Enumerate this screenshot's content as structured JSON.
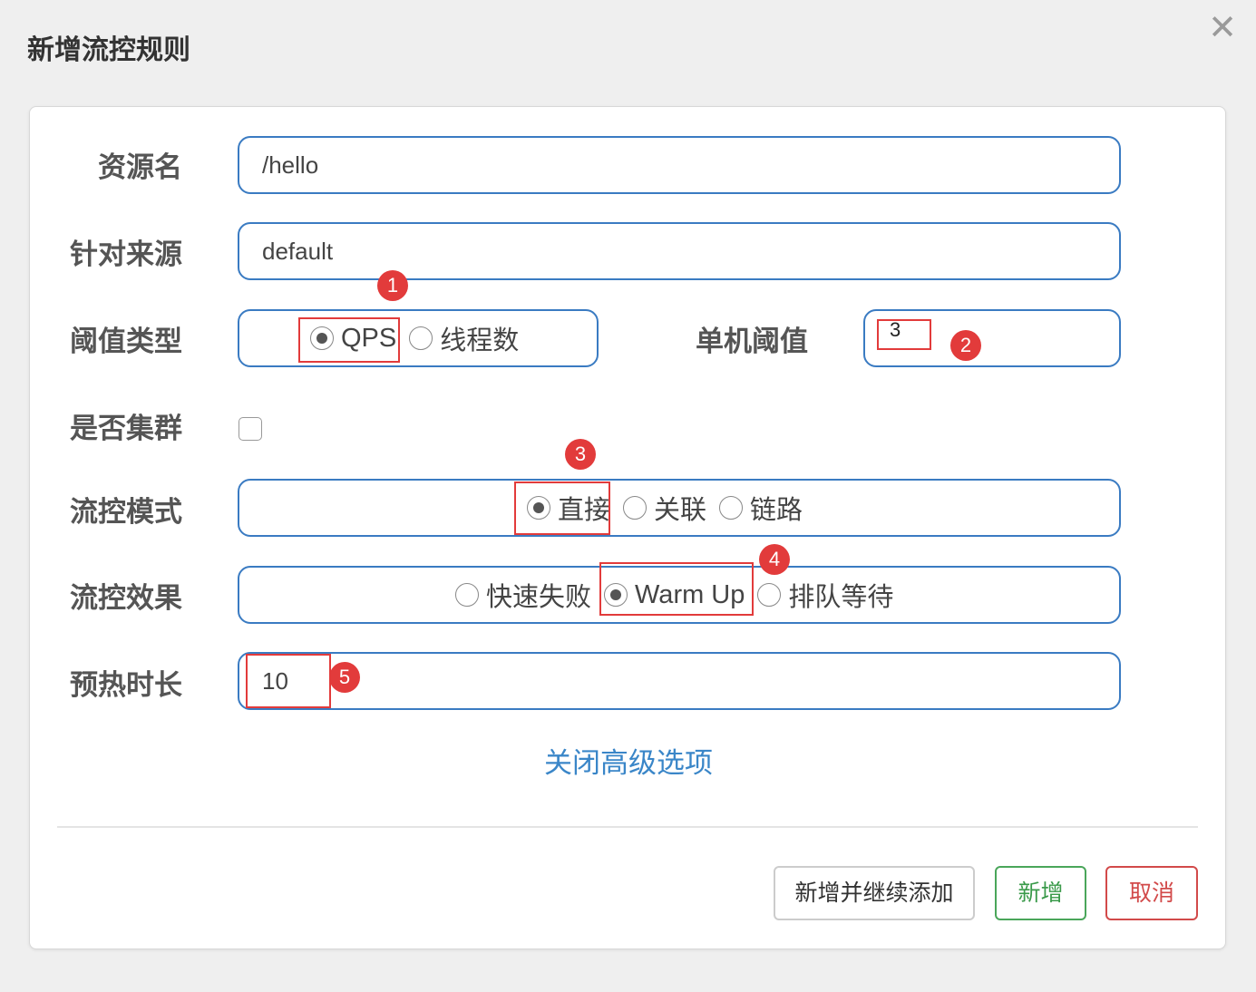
{
  "dialog": {
    "title": "新增流控规则",
    "close_glyph": "✕"
  },
  "form": {
    "resource": {
      "label": "资源名",
      "value": "/hello"
    },
    "limit_app": {
      "label": "针对来源",
      "value": "default"
    },
    "grade": {
      "label": "阈值类型",
      "options": [
        {
          "label": "QPS",
          "checked": true
        },
        {
          "label": "线程数",
          "checked": false
        }
      ]
    },
    "count": {
      "label": "单机阈值",
      "value": "3"
    },
    "cluster": {
      "label": "是否集群",
      "checked": false
    },
    "strategy": {
      "label": "流控模式",
      "options": [
        {
          "label": "直接",
          "checked": true
        },
        {
          "label": "关联",
          "checked": false
        },
        {
          "label": "链路",
          "checked": false
        }
      ]
    },
    "control_behavior": {
      "label": "流控效果",
      "options": [
        {
          "label": "快速失败",
          "checked": false
        },
        {
          "label": "Warm Up",
          "checked": true
        },
        {
          "label": "排队等待",
          "checked": false
        }
      ]
    },
    "warmup": {
      "label": "预热时长",
      "value": "10"
    },
    "toggle_advanced": "关闭高级选项"
  },
  "annotations": [
    "1",
    "2",
    "3",
    "4",
    "5"
  ],
  "buttons": {
    "add_continue": "新增并继续添加",
    "add": "新增",
    "cancel": "取消"
  },
  "colors": {
    "field_border": "#3a7bc2",
    "highlight": "#e23b3b",
    "link": "#3a86c8",
    "add_green": "#4aa65a",
    "cancel_red": "#d24a4a"
  }
}
